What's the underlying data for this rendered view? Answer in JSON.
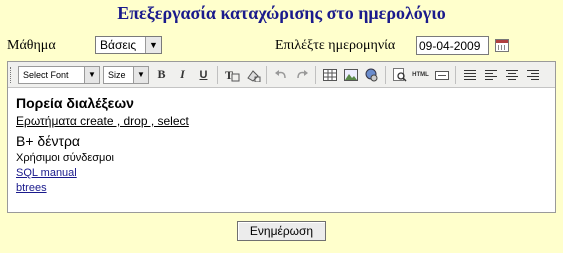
{
  "page": {
    "title": "Επεξεργασία καταχώρισης στο ημερολόγιο"
  },
  "form": {
    "subject_label": "Μάθημα",
    "subject_value": "Βάσεις",
    "date_label": "Επιλέξτε ημερομηνία",
    "date_value": "09-04-2009",
    "submit_label": "Ενημέρωση"
  },
  "toolbar": {
    "font_select": "Select Font",
    "size_select": "Size",
    "buttons": [
      {
        "name": "bold",
        "label": "B"
      },
      {
        "name": "italic",
        "label": "I"
      },
      {
        "name": "underline",
        "label": "U"
      },
      {
        "name": "html",
        "label": "HTML"
      }
    ]
  },
  "content": {
    "heading": "Πορεία διαλέξεων",
    "queries": "Ερωτήματα create , drop , select",
    "btree": "B+ δέντρα",
    "links_label": "Χρήσιμοι σύνδεσμοι",
    "link1": "SQL manual ",
    "link2": "btrees"
  }
}
